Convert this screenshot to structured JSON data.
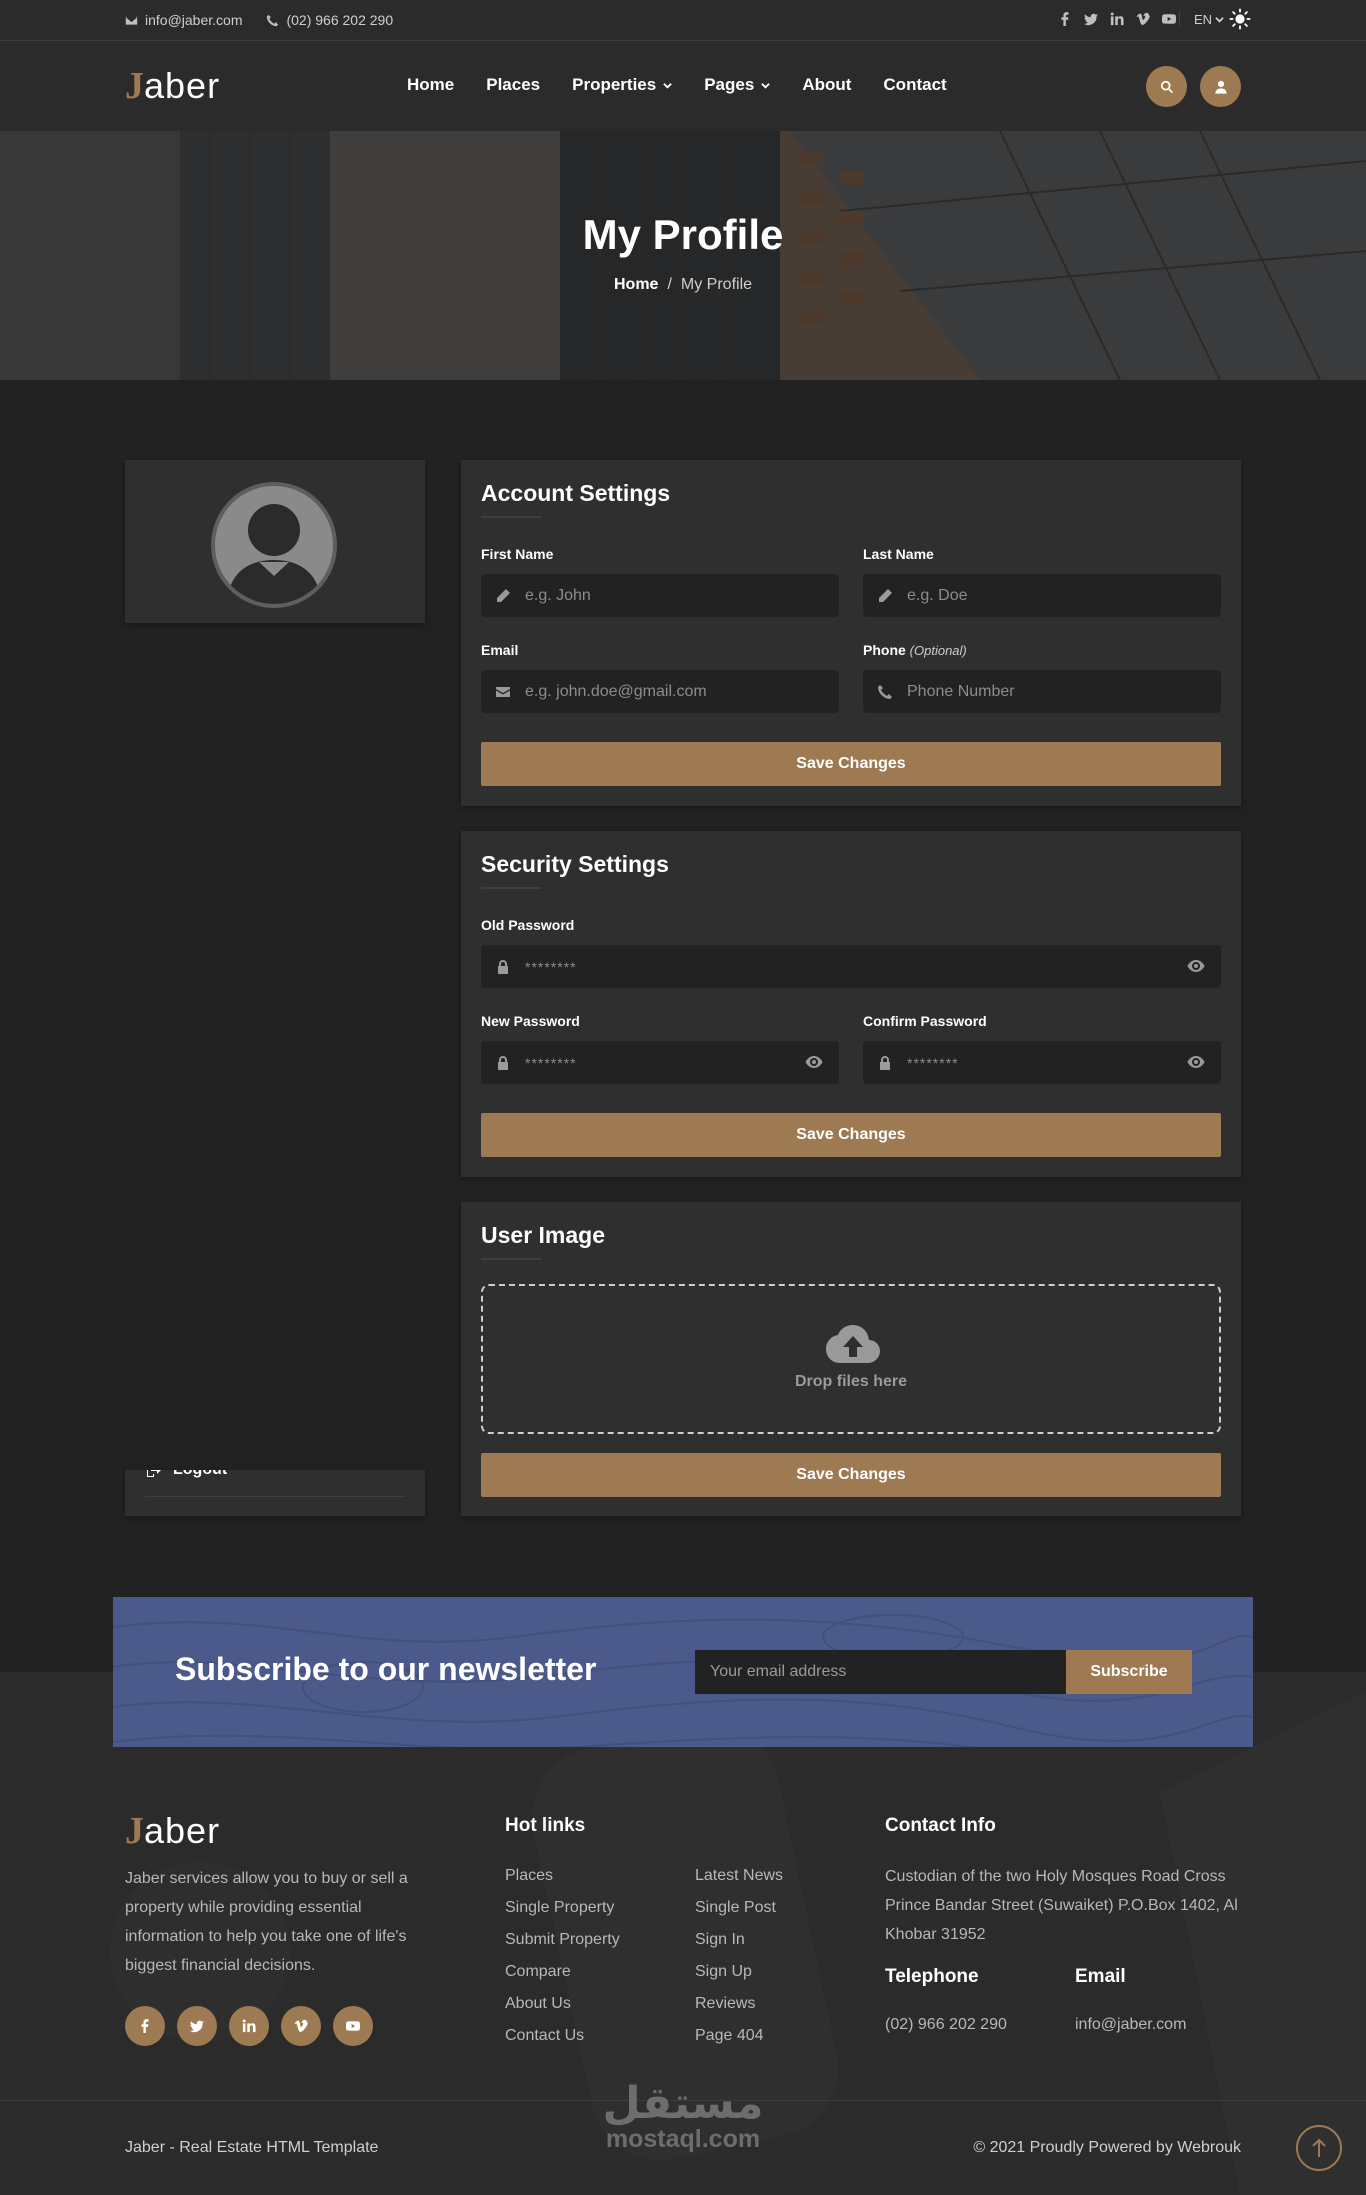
{
  "topbar": {
    "email": "info@jaber.com",
    "phone": "(02) 966 202 290",
    "language": "EN",
    "social_icons": [
      "facebook-icon",
      "twitter-icon",
      "linkedin-icon",
      "vimeo-icon",
      "youtube-icon"
    ]
  },
  "header": {
    "logo_initial": "J",
    "logo_rest": "aber",
    "nav": [
      "Home",
      "Places",
      "Properties",
      "Pages",
      "About",
      "Contact"
    ]
  },
  "hero": {
    "title": "My Profile",
    "breadcrumb_home": "Home",
    "breadcrumb_sep": "/",
    "breadcrumb_current": "My Profile"
  },
  "sidebar": {
    "logout_label": "Logout"
  },
  "account": {
    "title": "Account Settings",
    "first_name_label": "First Name",
    "first_name_placeholder": "e.g. John",
    "last_name_label": "Last Name",
    "last_name_placeholder": "e.g. Doe",
    "email_label": "Email",
    "email_placeholder": "e.g. john.doe@gmail.com",
    "phone_label": "Phone",
    "phone_optional": "(Optional)",
    "phone_placeholder": "Phone Number",
    "save_label": "Save Changes"
  },
  "security": {
    "title": "Security Settings",
    "old_password_label": "Old Password",
    "old_password_placeholder": "********",
    "new_password_label": "New Password",
    "new_password_placeholder": "********",
    "confirm_password_label": "Confirm Password",
    "confirm_password_placeholder": "********",
    "save_label": "Save Changes"
  },
  "user_image": {
    "title": "User Image",
    "drop_text": "Drop files here",
    "save_label": "Save Changes"
  },
  "newsletter": {
    "title": "Subscribe to our newsletter",
    "email_placeholder": "Your email address",
    "button_label": "Subscribe"
  },
  "footer": {
    "logo_initial": "J",
    "logo_rest": "aber",
    "description": "Jaber services allow you to buy or sell a property while providing essential information to help you take one of life's biggest financial decisions.",
    "hot_links_title": "Hot links",
    "hot_links_col1": [
      "Places",
      "Single Property",
      "Submit Property",
      "Compare",
      "About Us",
      "Contact Us"
    ],
    "hot_links_col2": [
      "Latest News",
      "Single Post",
      "Sign In",
      "Sign Up",
      "Reviews",
      "Page 404"
    ],
    "contact_title": "Contact Info",
    "address": "Custodian of the two Holy Mosques Road Cross Prince Bandar Street (Suwaiket) P.O.Box 1402, Al Khobar 31952",
    "telephone_title": "Telephone",
    "telephone": "(02) 966 202 290",
    "email_title": "Email",
    "email": "info@jaber.com",
    "copyright_left": "Jaber - Real Estate HTML Template",
    "copyright_right": "© 2021 Proudly Powered by Webrouk",
    "social_icons": [
      "facebook-icon",
      "twitter-icon",
      "linkedin-icon",
      "vimeo-icon",
      "youtube-icon"
    ]
  },
  "watermark": {
    "arabic": "مستقل",
    "latin": "mostaql.com"
  },
  "colors": {
    "accent": "#9d7a51",
    "background": "#222222",
    "panel": "#2f2f2f",
    "newsletter": "#4b5a8a"
  }
}
